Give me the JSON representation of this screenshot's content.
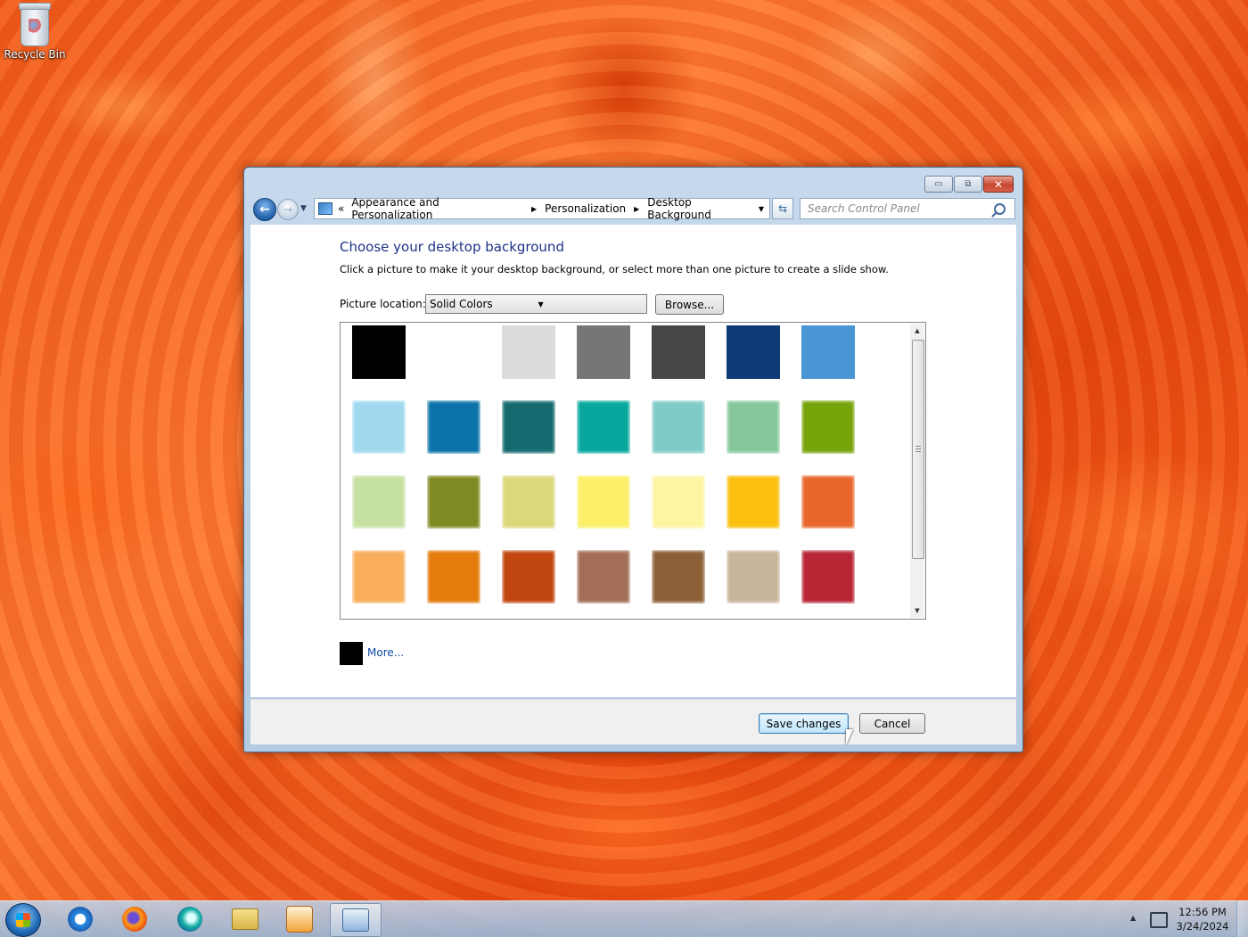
{
  "desktop": {
    "icons": [
      {
        "label": "Recycle Bin",
        "icon": "recycle-bin-icon"
      }
    ]
  },
  "window": {
    "caption_buttons": {
      "minimize": "▭",
      "maximize": "⧉",
      "close": "✕"
    },
    "address": {
      "overflow": "«",
      "segments": [
        "Appearance and Personalization",
        "Personalization",
        "Desktop Background"
      ],
      "separator": "▶",
      "dropdown": "▼"
    },
    "refresh_glyph": "⇆",
    "search": {
      "placeholder": "Search Control Panel"
    }
  },
  "main": {
    "title": "Choose your desktop background",
    "description": "Click a picture to make it your desktop background, or select more than one picture to create a slide show.",
    "picture_location": {
      "label": "Picture location:",
      "value": "Solid Colors",
      "arrow": "▼"
    },
    "browse_label": "Browse...",
    "scroll": {
      "up": "▲",
      "down": "▼"
    },
    "swatches": [
      [
        "#000000",
        "#ffffff",
        "#dcdcdc",
        "#767676",
        "#464646",
        "#0e3b78",
        "#4a95d4"
      ],
      [
        "#a0d8ee",
        "#0a72a8",
        "#146a6e",
        "#07a79d",
        "#7fcbc8",
        "#86c89c",
        "#76a40b"
      ],
      [
        "#c6e0a2",
        "#7f8a23",
        "#dad878",
        "#fbf068",
        "#fdf5a2",
        "#fcc00f",
        "#e8662b"
      ],
      [
        "#f9ae5c",
        "#e47b0d",
        "#c1460f",
        "#a36e55",
        "#8c6037",
        "#c8b49a",
        "#b82535"
      ]
    ],
    "current_color": "#000000",
    "more_label": "More..."
  },
  "footer": {
    "save_label": "Save changes",
    "cancel_label": "Cancel"
  },
  "taskbar": {
    "items": [
      "internet-explorer-icon",
      "firefox-icon",
      "edge-icon",
      "file-explorer-icon",
      "media-player-icon",
      "control-panel-icon"
    ],
    "active_item": "control-panel-icon",
    "tray_arrow": "▲",
    "clock": {
      "time": "12:56 PM",
      "date": "3/24/2024"
    }
  }
}
